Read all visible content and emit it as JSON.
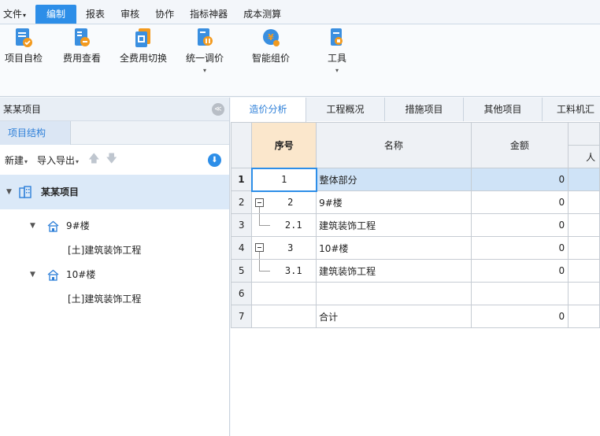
{
  "menubar": {
    "items": [
      "文件",
      "编制",
      "报表",
      "审核",
      "协作",
      "指标神器",
      "成本测算"
    ],
    "active_index": 1
  },
  "ribbon": {
    "tools": [
      {
        "label": "项目自检",
        "icon": "check-doc-icon",
        "has_dropdown": false
      },
      {
        "label": "费用查看",
        "icon": "fee-view-icon",
        "has_dropdown": false
      },
      {
        "label": "全费用切换",
        "icon": "switch-icon",
        "has_dropdown": false
      },
      {
        "label": "统一调价",
        "icon": "price-adjust-icon",
        "has_dropdown": true
      },
      {
        "label": "智能组价",
        "icon": "smart-pricing-icon",
        "has_dropdown": false
      },
      {
        "label": "工具",
        "icon": "tools-icon",
        "has_dropdown": true
      }
    ]
  },
  "left_panel": {
    "title": "某某项目",
    "tab": "项目结构",
    "toolbar": {
      "new": "新建",
      "import_export": "导入导出"
    },
    "tree": {
      "root": "某某项目",
      "nodes": [
        {
          "label": "9#楼",
          "children": [
            "[土]建筑装饰工程"
          ]
        },
        {
          "label": "10#楼",
          "children": [
            "[土]建筑装饰工程"
          ]
        }
      ]
    }
  },
  "right_panel": {
    "tabs": [
      "造价分析",
      "工程概况",
      "措施项目",
      "其他项目",
      "工料机汇"
    ],
    "active_tab": 0,
    "table": {
      "headers": {
        "seq": "序号",
        "name": "名称",
        "amount": "金额",
        "extra_top": "",
        "extra_bottom": "人"
      },
      "rows": [
        {
          "rn": "1",
          "seq": "1",
          "name": "整体部分",
          "amount": "0",
          "toggle": "none",
          "selected": true
        },
        {
          "rn": "2",
          "seq": "2",
          "name": "9#楼",
          "amount": "0",
          "toggle": "minus"
        },
        {
          "rn": "3",
          "seq": "2.1",
          "name": "建筑装饰工程",
          "amount": "0",
          "toggle": "line"
        },
        {
          "rn": "4",
          "seq": "3",
          "name": "10#楼",
          "amount": "0",
          "toggle": "minus"
        },
        {
          "rn": "5",
          "seq": "3.1",
          "name": "建筑装饰工程",
          "amount": "0",
          "toggle": "line"
        },
        {
          "rn": "6",
          "seq": "",
          "name": "",
          "amount": "",
          "toggle": "none"
        },
        {
          "rn": "7",
          "seq": "",
          "name": "合计",
          "amount": "0",
          "toggle": "none"
        }
      ]
    }
  },
  "colors": {
    "accent": "#2d8ee8",
    "selected_row": "#cfe3f7",
    "seq_header": "#fbe7cc"
  }
}
